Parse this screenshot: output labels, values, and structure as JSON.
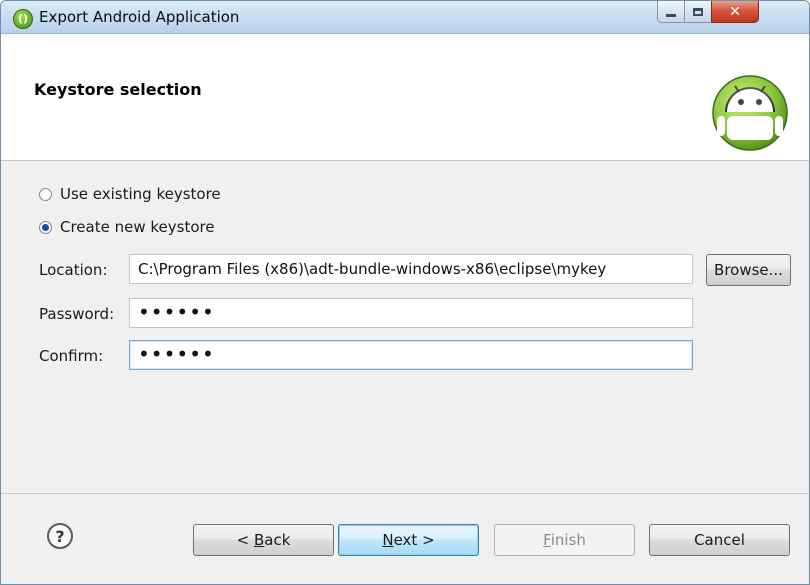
{
  "window": {
    "title": "Export Android Application",
    "controls": {
      "minimize": "minimize-icon",
      "maximize": "maximize-icon",
      "close": "close-icon"
    }
  },
  "header": {
    "title": "Keystore selection",
    "logo_icon": "android-logo"
  },
  "keystore_options": {
    "use_existing": {
      "label": "Use existing keystore",
      "selected": false
    },
    "create_new": {
      "label": "Create new keystore",
      "selected": true
    }
  },
  "form": {
    "location_label": "Location:",
    "location_value": "C:\\Program Files (x86)\\adt-bundle-windows-x86\\eclipse\\mykey",
    "browse_label": "Browse...",
    "password_label": "Password:",
    "password_value": "••••••",
    "confirm_label": "Confirm:",
    "confirm_value": "••••••"
  },
  "footer": {
    "help_icon": "help-icon",
    "back_accel": "B",
    "back_rest": "ack",
    "back_prefix": "< ",
    "next_accel": "N",
    "next_rest": "ext >",
    "finish_accel": "F",
    "finish_rest": "inish",
    "cancel_label": "Cancel"
  }
}
